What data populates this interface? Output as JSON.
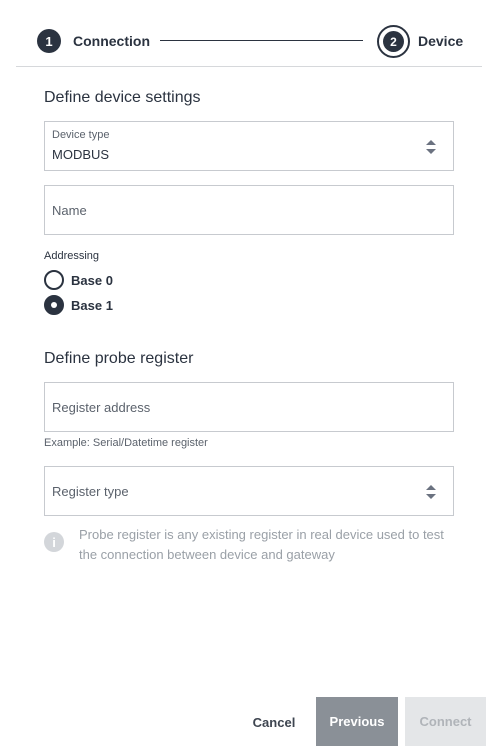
{
  "stepper": {
    "steps": [
      {
        "number": "1",
        "label": "Connection",
        "state": "completed"
      },
      {
        "number": "2",
        "label": "Device",
        "state": "active"
      }
    ]
  },
  "device_settings": {
    "title": "Define device settings",
    "device_type": {
      "label": "Device type",
      "value": "MODBUS"
    },
    "name": {
      "placeholder": "Name",
      "value": ""
    },
    "addressing": {
      "label": "Addressing",
      "options": [
        {
          "label": "Base 0",
          "checked": false
        },
        {
          "label": "Base 1",
          "checked": true
        }
      ]
    }
  },
  "probe_register": {
    "title": "Define probe register",
    "register_address": {
      "placeholder": "Register address",
      "hint": "Example: Serial/Datetime register"
    },
    "register_type": {
      "placeholder": "Register type"
    },
    "info": "Probe register is any existing register in real device used to test the connection between device and gateway"
  },
  "footer": {
    "cancel_label": "Cancel",
    "previous_label": "Previous",
    "connect_label": "Connect",
    "connect_disabled": true
  },
  "colors": {
    "primary": "#2b3340",
    "previous_button": "#8a9097",
    "disabled_button": "#e4e6e8",
    "border": "#c7cacf"
  },
  "icons": {
    "select_arrows": "sort-arrows-icon",
    "info": "info-icon"
  }
}
